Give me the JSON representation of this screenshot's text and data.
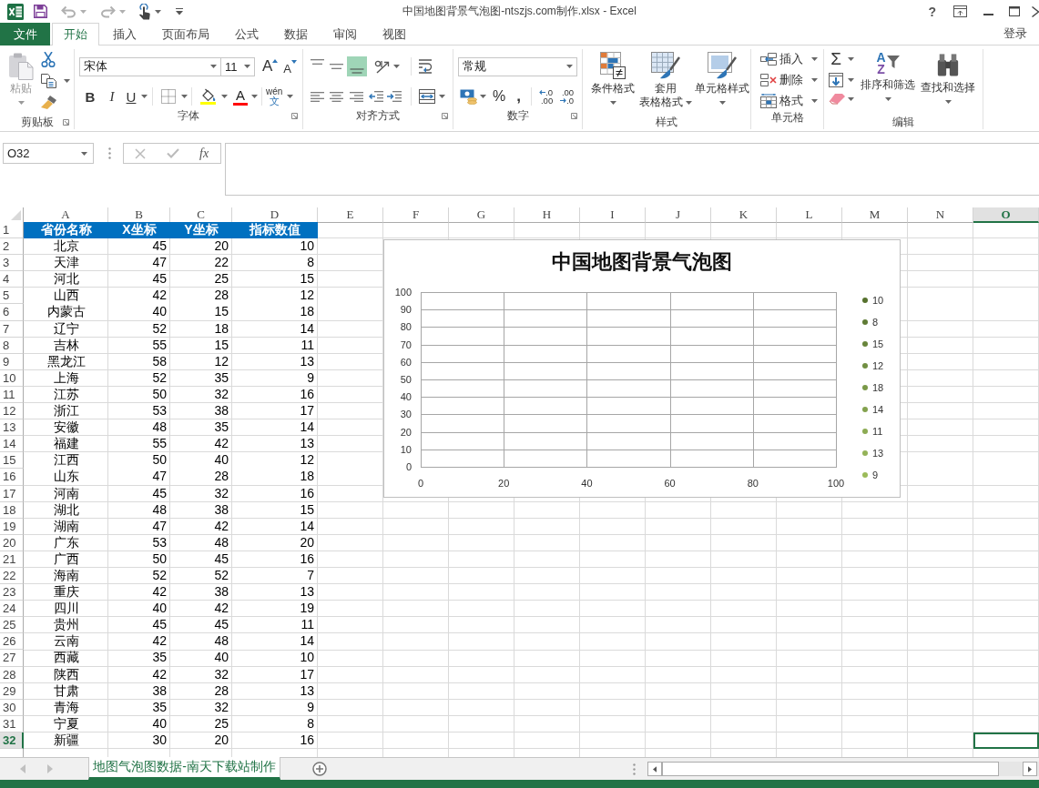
{
  "window": {
    "title": "中国地图背景气泡图-ntszjs.com制作.xlsx - Excel",
    "help": "?"
  },
  "quick_access": [
    {
      "kind": "save",
      "disabled": false
    },
    {
      "kind": "undo",
      "disabled": true
    },
    {
      "kind": "redo",
      "disabled": true
    },
    {
      "kind": "touch",
      "disabled": false
    },
    {
      "kind": "customize",
      "disabled": false
    }
  ],
  "ribbon_tabs": {
    "file": "文件",
    "tabs": [
      {
        "label": "开始",
        "selected": true
      },
      {
        "label": "插入",
        "selected": false
      },
      {
        "label": "页面布局",
        "selected": false
      },
      {
        "label": "公式",
        "selected": false
      },
      {
        "label": "数据",
        "selected": false
      },
      {
        "label": "审阅",
        "selected": false
      },
      {
        "label": "视图",
        "selected": false
      }
    ],
    "sign_in": "登录"
  },
  "ribbon": {
    "groups": [
      {
        "kind": "clipboard",
        "title": "剪贴板",
        "paste": {
          "label": "粘贴",
          "disabled": true
        }
      },
      {
        "kind": "font",
        "title": "字体",
        "font_name": "宋体",
        "font_size": "11",
        "grow_font": "A",
        "shrink_font": "A",
        "bold": "B",
        "italic": "I",
        "underline": "U",
        "font_color": "A",
        "phonetic": {
          "pinyin": "wén",
          "character": "文"
        }
      },
      {
        "kind": "alignment",
        "title": "对齐方式",
        "vertical_align": [
          {
            "selected": false
          },
          {
            "selected": false
          },
          {
            "selected": true
          }
        ]
      },
      {
        "kind": "number",
        "title": "数字",
        "format": "常规",
        "percent": "%",
        "comma": ",",
        "increase_decimal": {
          "top": ".0",
          "bottom": ".00"
        },
        "decrease_decimal": {
          "top": ".00",
          "bottom": ".0"
        }
      },
      {
        "kind": "styles",
        "title": "样式",
        "buttons": [
          {
            "kind": "conditional",
            "lines": [
              "条件格式"
            ]
          },
          {
            "kind": "table",
            "lines": [
              "套用",
              "表格格式"
            ]
          },
          {
            "kind": "cell",
            "lines": [
              "单元格样式"
            ]
          }
        ]
      },
      {
        "kind": "cells",
        "title": "单元格",
        "buttons": [
          {
            "kind": "insert",
            "label": "插入"
          },
          {
            "kind": "delete",
            "label": "删除"
          },
          {
            "kind": "format",
            "label": "格式"
          }
        ]
      },
      {
        "kind": "editing",
        "title": "编辑",
        "autosum": "Σ",
        "sort": {
          "letters": [
            "A",
            "Z"
          ],
          "label": "排序和筛选"
        },
        "find": "查找和选择"
      }
    ]
  },
  "formula_bar": {
    "name_box": "O32",
    "insert_function": "fx"
  },
  "sheet": {
    "columns": [
      {
        "label": "A",
        "selected": false
      },
      {
        "label": "B",
        "selected": false
      },
      {
        "label": "C",
        "selected": false
      },
      {
        "label": "D",
        "selected": false
      },
      {
        "label": "E",
        "selected": false
      },
      {
        "label": "F",
        "selected": false
      },
      {
        "label": "G",
        "selected": false
      },
      {
        "label": "H",
        "selected": false
      },
      {
        "label": "I",
        "selected": false
      },
      {
        "label": "J",
        "selected": false
      },
      {
        "label": "K",
        "selected": false
      },
      {
        "label": "L",
        "selected": false
      },
      {
        "label": "M",
        "selected": false
      },
      {
        "label": "N",
        "selected": false
      },
      {
        "label": "O",
        "selected": true
      }
    ],
    "header_row": {
      "number": "1",
      "selected": false,
      "cells": [
        "省份名称",
        "X坐标",
        "Y坐标",
        "指标数值"
      ]
    },
    "rows": [
      {
        "number": "2",
        "selected": false,
        "cells": [
          "北京",
          "45",
          "20",
          "10"
        ]
      },
      {
        "number": "3",
        "selected": false,
        "cells": [
          "天津",
          "47",
          "22",
          "8"
        ]
      },
      {
        "number": "4",
        "selected": false,
        "cells": [
          "河北",
          "45",
          "25",
          "15"
        ]
      },
      {
        "number": "5",
        "selected": false,
        "cells": [
          "山西",
          "42",
          "28",
          "12"
        ]
      },
      {
        "number": "6",
        "selected": false,
        "cells": [
          "内蒙古",
          "40",
          "15",
          "18"
        ]
      },
      {
        "number": "7",
        "selected": false,
        "cells": [
          "辽宁",
          "52",
          "18",
          "14"
        ]
      },
      {
        "number": "8",
        "selected": false,
        "cells": [
          "吉林",
          "55",
          "15",
          "11"
        ]
      },
      {
        "number": "9",
        "selected": false,
        "cells": [
          "黑龙江",
          "58",
          "12",
          "13"
        ]
      },
      {
        "number": "10",
        "selected": false,
        "cells": [
          "上海",
          "52",
          "35",
          "9"
        ]
      },
      {
        "number": "11",
        "selected": false,
        "cells": [
          "江苏",
          "50",
          "32",
          "16"
        ]
      },
      {
        "number": "12",
        "selected": false,
        "cells": [
          "浙江",
          "53",
          "38",
          "17"
        ]
      },
      {
        "number": "13",
        "selected": false,
        "cells": [
          "安徽",
          "48",
          "35",
          "14"
        ]
      },
      {
        "number": "14",
        "selected": false,
        "cells": [
          "福建",
          "55",
          "42",
          "13"
        ]
      },
      {
        "number": "15",
        "selected": false,
        "cells": [
          "江西",
          "50",
          "40",
          "12"
        ]
      },
      {
        "number": "16",
        "selected": false,
        "cells": [
          "山东",
          "47",
          "28",
          "18"
        ]
      },
      {
        "number": "17",
        "selected": false,
        "cells": [
          "河南",
          "45",
          "32",
          "16"
        ]
      },
      {
        "number": "18",
        "selected": false,
        "cells": [
          "湖北",
          "48",
          "38",
          "15"
        ]
      },
      {
        "number": "19",
        "selected": false,
        "cells": [
          "湖南",
          "47",
          "42",
          "14"
        ]
      },
      {
        "number": "20",
        "selected": false,
        "cells": [
          "广东",
          "53",
          "48",
          "20"
        ]
      },
      {
        "number": "21",
        "selected": false,
        "cells": [
          "广西",
          "50",
          "45",
          "16"
        ]
      },
      {
        "number": "22",
        "selected": false,
        "cells": [
          "海南",
          "52",
          "52",
          "7"
        ]
      },
      {
        "number": "23",
        "selected": false,
        "cells": [
          "重庆",
          "42",
          "38",
          "13"
        ]
      },
      {
        "number": "24",
        "selected": false,
        "cells": [
          "四川",
          "40",
          "42",
          "19"
        ]
      },
      {
        "number": "25",
        "selected": false,
        "cells": [
          "贵州",
          "45",
          "45",
          "11"
        ]
      },
      {
        "number": "26",
        "selected": false,
        "cells": [
          "云南",
          "42",
          "48",
          "14"
        ]
      },
      {
        "number": "27",
        "selected": false,
        "cells": [
          "西藏",
          "35",
          "40",
          "10"
        ]
      },
      {
        "number": "28",
        "selected": false,
        "cells": [
          "陕西",
          "42",
          "32",
          "17"
        ]
      },
      {
        "number": "29",
        "selected": false,
        "cells": [
          "甘肃",
          "38",
          "28",
          "13"
        ]
      },
      {
        "number": "30",
        "selected": false,
        "cells": [
          "青海",
          "35",
          "32",
          "9"
        ]
      },
      {
        "number": "31",
        "selected": false,
        "cells": [
          "宁夏",
          "40",
          "25",
          "8"
        ]
      },
      {
        "number": "32",
        "selected": true,
        "cells": [
          "新疆",
          "30",
          "20",
          "16"
        ]
      }
    ],
    "chart": {
      "chart_data": {
        "type": "scatter",
        "title": "中国地图背景气泡图",
        "categories": [
          "0",
          "20",
          "40",
          "60",
          "80",
          "100"
        ],
        "ylim": [
          0,
          100
        ],
        "yticks": [
          0,
          10,
          20,
          30,
          40,
          50,
          60,
          70,
          80,
          90,
          100
        ],
        "grid": true,
        "series": [
          {
            "name": "10",
            "color": "#56712e",
            "values": [
              null,
              null,
              null,
              null,
              null,
              null
            ]
          },
          {
            "name": "8",
            "color": "#5f7b35",
            "values": [
              null,
              null,
              null,
              null,
              null,
              null
            ]
          },
          {
            "name": "15",
            "color": "#68853b",
            "values": [
              null,
              null,
              null,
              null,
              null,
              null
            ]
          },
          {
            "name": "12",
            "color": "#718f42",
            "values": [
              null,
              null,
              null,
              null,
              null,
              null
            ]
          },
          {
            "name": "18",
            "color": "#7a9948",
            "values": [
              null,
              null,
              null,
              null,
              null,
              null
            ]
          },
          {
            "name": "14",
            "color": "#83a24e",
            "values": [
              null,
              null,
              null,
              null,
              null,
              null
            ]
          },
          {
            "name": "11",
            "color": "#8cab53",
            "values": [
              null,
              null,
              null,
              null,
              null,
              null
            ]
          },
          {
            "name": "13",
            "color": "#94b358",
            "values": [
              null,
              null,
              null,
              null,
              null,
              null
            ]
          },
          {
            "name": "9",
            "color": "#9bbb59",
            "values": [
              null,
              null,
              null,
              null,
              null,
              null
            ]
          }
        ]
      }
    }
  },
  "sheet_tabs": [
    {
      "label": "地图气泡图数据-南天下载站制作",
      "selected": true
    }
  ]
}
